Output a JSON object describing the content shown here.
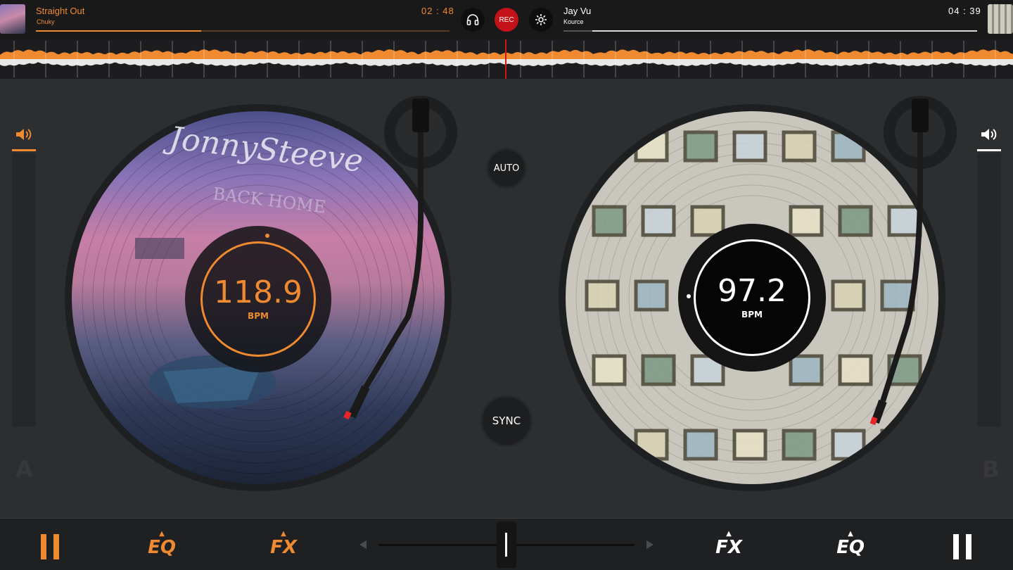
{
  "colors": {
    "accent": "#f08a30",
    "deck_b": "#ffffff",
    "rec": "#c4121b"
  },
  "deck_a": {
    "title": "Straight Out",
    "artist": "Chuky",
    "time": "02 : 48",
    "progress": 0.4,
    "bpm": "118.9",
    "bpm_label": "BPM",
    "label_line1": "JonnySteeve",
    "label_line2": "BACK HOME",
    "letter": "A",
    "volume_icon": "speaker-icon"
  },
  "deck_b": {
    "title": "Jay Vu",
    "artist": "Kource",
    "time": "04 : 39",
    "progress": 0.07,
    "bpm": "97.2",
    "bpm_label": "BPM",
    "letter": "B",
    "volume_icon": "speaker-icon"
  },
  "center": {
    "headphones_icon": "headphones-icon",
    "rec_label": "REC",
    "settings_icon": "gear-icon",
    "auto_label": "AUTO",
    "sync_label": "SYNC"
  },
  "bottom": {
    "eq_a": "EQ",
    "fx_a": "FX",
    "fx_b": "FX",
    "eq_b": "EQ",
    "crossfader": 0.5
  }
}
